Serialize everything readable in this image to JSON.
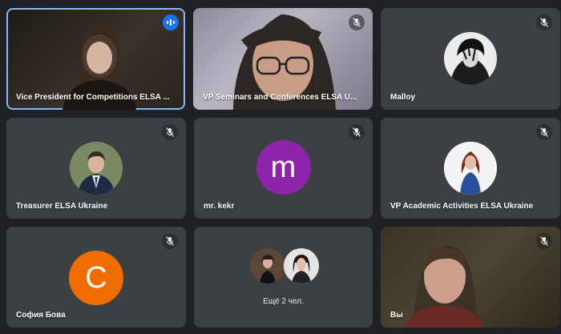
{
  "participants": [
    {
      "name": "Vice President for Competitions ELSA ...",
      "speaking": true
    },
    {
      "name": "VP Seminars and Conferences ELSA U...",
      "muted": true
    },
    {
      "name": "Malloy",
      "muted": true
    },
    {
      "name": "Treasurer ELSA Ukraine",
      "muted": true
    },
    {
      "name": "mr. kekr",
      "muted": true,
      "avatar_letter": "m",
      "avatar_color": "#8e24aa"
    },
    {
      "name": "VP Academic Activities ELSA Ukraine",
      "muted": true
    },
    {
      "name": "София Бова",
      "muted": true,
      "avatar_letter": "С",
      "avatar_color": "#ef6c00"
    },
    {
      "more_label": "Ещё 2 чел."
    },
    {
      "name": "Вы",
      "muted": true
    }
  ],
  "colors": {
    "background": "#202124",
    "tile": "#3c4043",
    "active_border": "#8ab4f8",
    "speaking_badge": "#1a73e8"
  },
  "icons": {
    "muted": "mic-off-icon",
    "speaking": "audio-level-icon"
  }
}
